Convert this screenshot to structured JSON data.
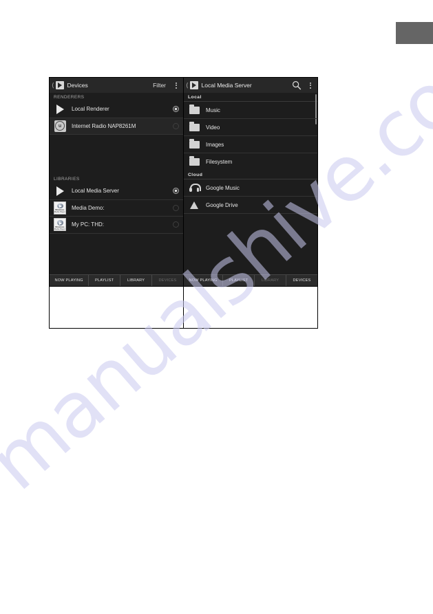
{
  "page": {
    "watermark_text": "manualshive.com",
    "corner_block_color": "#656565"
  },
  "screens": [
    {
      "id": "devices-screen",
      "action_bar": {
        "back_icon": "back-chevron-icon",
        "app_icon": "play-app-icon",
        "title": "Devices",
        "filter_label": "Filter",
        "overflow_icon": "overflow-menu-icon"
      },
      "sections": [
        {
          "header": "RENDERERS",
          "items": [
            {
              "label": "Local Renderer",
              "icon": "play-icon",
              "selected": true
            },
            {
              "label": "Internet Radio NAP8261M",
              "icon": "internet-radio-icon",
              "selected": false
            }
          ]
        },
        {
          "header": "LIBRARIES",
          "items": [
            {
              "label": "Local Media Server",
              "icon": "play-icon",
              "selected": true
            },
            {
              "label": "Media Demo:",
              "icon": "windows-media-player-icon",
              "selected": false
            },
            {
              "label": "My PC:  THD:",
              "icon": "windows-media-player-icon",
              "selected": false
            }
          ]
        }
      ],
      "tabs": [
        {
          "label": "NOW PLAYING",
          "current": false
        },
        {
          "label": "PLAYLIST",
          "current": false
        },
        {
          "label": "LIBRARY",
          "current": false
        },
        {
          "label": "DEVICES",
          "current": true
        }
      ]
    },
    {
      "id": "library-screen",
      "action_bar": {
        "back_icon": "back-chevron-icon",
        "app_icon": "play-app-icon",
        "title": "Local Media Server",
        "search_icon": "search-icon",
        "overflow_icon": "overflow-menu-icon"
      },
      "sections": [
        {
          "header": "Local",
          "items": [
            {
              "label": "Music",
              "icon": "folder-icon"
            },
            {
              "label": "Video",
              "icon": "folder-icon"
            },
            {
              "label": "Images",
              "icon": "folder-icon"
            },
            {
              "label": "Filesystem",
              "icon": "folder-icon"
            }
          ]
        },
        {
          "header": "Cloud",
          "items": [
            {
              "label": "Google Music",
              "icon": "headphones-icon"
            },
            {
              "label": "Google Drive",
              "icon": "google-drive-icon"
            }
          ]
        }
      ],
      "tabs": [
        {
          "label": "NOW PLAYING",
          "current": false
        },
        {
          "label": "PLAYLIST",
          "current": false
        },
        {
          "label": "LIBRARY",
          "current": true
        },
        {
          "label": "DEVICES",
          "current": false
        }
      ]
    }
  ]
}
